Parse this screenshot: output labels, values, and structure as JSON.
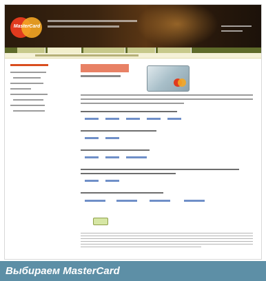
{
  "caption": "Выбираем MasterCard",
  "logo": {
    "text": "MasterCard",
    "colors": {
      "red": "#e03a1e",
      "yellow": "#f4a623"
    }
  },
  "icons": [
    "mastercard-logo-icon",
    "credit-card-icon"
  ]
}
